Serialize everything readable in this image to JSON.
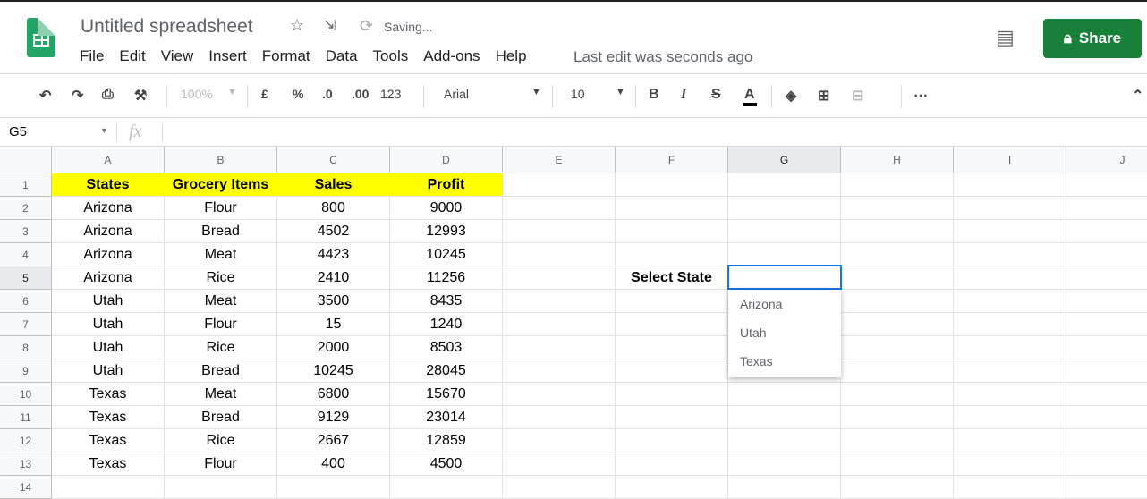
{
  "title": "Untitled spreadsheet",
  "saving": "Saving...",
  "menu": [
    "File",
    "Edit",
    "View",
    "Insert",
    "Format",
    "Data",
    "Tools",
    "Add-ons",
    "Help"
  ],
  "last_edit": "Last edit was seconds ago",
  "share": "Share",
  "toolbar": {
    "zoom": "100%",
    "currency": "£",
    "percent": "%",
    "dec_less": ".0",
    "dec_more": ".00",
    "format": "123",
    "font": "Arial",
    "size": "10"
  },
  "name_box": "G5",
  "fx": "fx",
  "columns": [
    "A",
    "B",
    "C",
    "D",
    "E",
    "F",
    "G",
    "H",
    "I",
    "J"
  ],
  "rows": [
    [
      "States",
      "Grocery Items",
      "Sales",
      "Profit"
    ],
    [
      "Arizona",
      "Flour",
      "800",
      "9000"
    ],
    [
      "Arizona",
      "Bread",
      "4502",
      "12993"
    ],
    [
      "Arizona",
      "Meat",
      "4423",
      "10245"
    ],
    [
      "Arizona",
      "Rice",
      "2410",
      "11256"
    ],
    [
      "Utah",
      "Meat",
      "3500",
      "8435"
    ],
    [
      "Utah",
      "Flour",
      "15",
      "1240"
    ],
    [
      "Utah",
      "Rice",
      "2000",
      "8503"
    ],
    [
      "Utah",
      "Bread",
      "10245",
      "28045"
    ],
    [
      "Texas",
      "Meat",
      "6800",
      "15670"
    ],
    [
      "Texas",
      "Bread",
      "9129",
      "23014"
    ],
    [
      "Texas",
      "Rice",
      "2667",
      "12859"
    ],
    [
      "Texas",
      "Flour",
      "400",
      "4500"
    ],
    [
      "",
      "",
      "",
      ""
    ]
  ],
  "select_label": "Select State",
  "dropdown_options": [
    "Arizona",
    "Utah",
    "Texas"
  ],
  "colors": {
    "header_fill": "#ffff00",
    "share": "#188038",
    "selection": "#1a73e8"
  }
}
